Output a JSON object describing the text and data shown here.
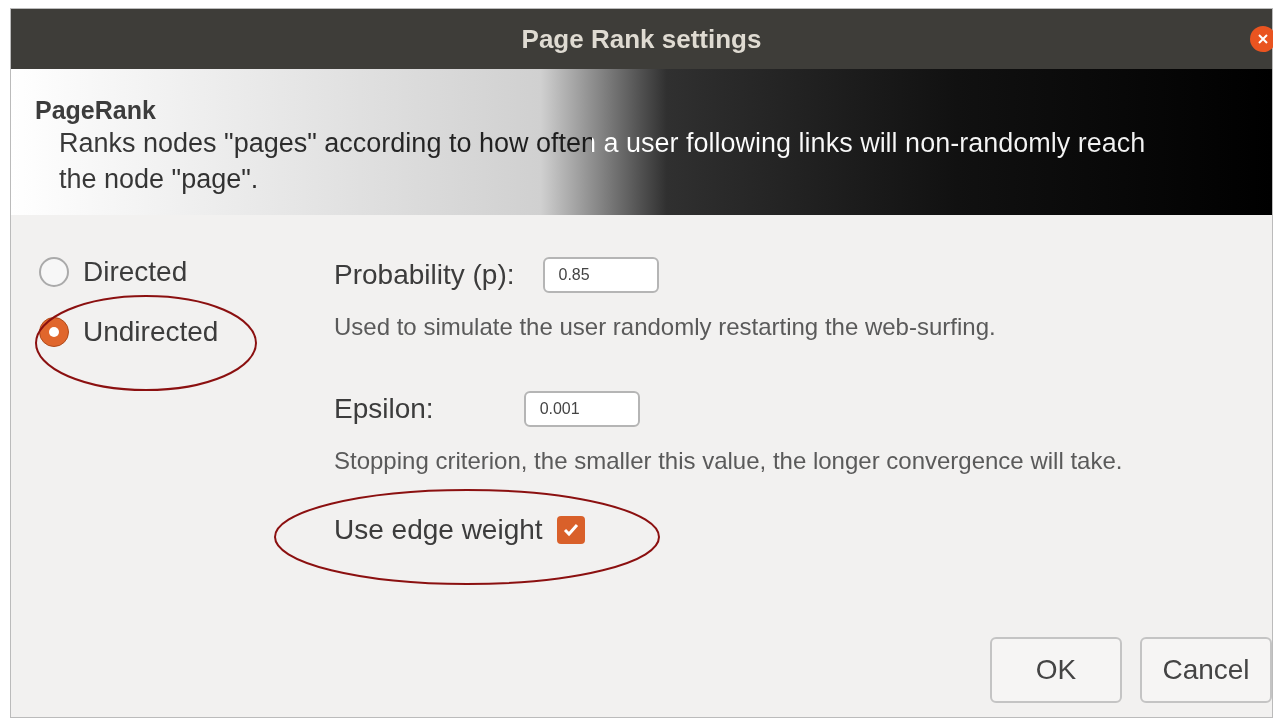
{
  "window": {
    "title": "Page Rank settings"
  },
  "header": {
    "title": "PageRank",
    "description": "Ranks nodes \"pages\" according to how often a user following links will non-randomly reach the node \"page\"."
  },
  "graph_type": [
    {
      "label": "Directed",
      "selected": false
    },
    {
      "label": "Undirected",
      "selected": true
    }
  ],
  "probability": {
    "label": "Probability (p):",
    "value": "0.85",
    "help": "Used to simulate the user randomly restarting the web-surfing."
  },
  "epsilon": {
    "label": "Epsilon:",
    "value": "0.001",
    "help": "Stopping criterion, the smaller this value, the longer convergence will take."
  },
  "edge_weight": {
    "label": "Use edge weight",
    "checked": true
  },
  "buttons": [
    "OK",
    "Cancel"
  ]
}
